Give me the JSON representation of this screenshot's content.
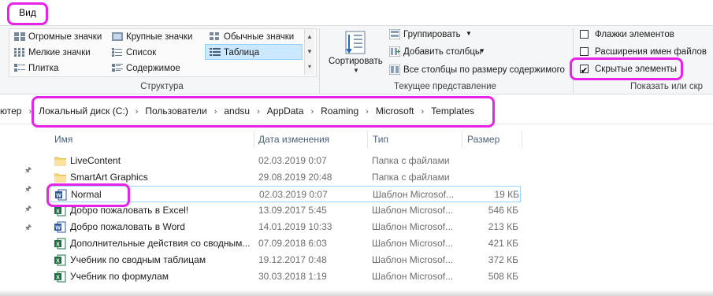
{
  "tabs": {
    "view": "Вид"
  },
  "ribbon": {
    "layout": {
      "col1": [
        "Огромные значки",
        "Мелкие значки",
        "Плитка"
      ],
      "col2": [
        "Крупные значки",
        "Список",
        "Содержимое"
      ],
      "col3": [
        "Обычные значки",
        "Таблица"
      ],
      "selected": "Таблица",
      "group_label": "Структура"
    },
    "current_view": {
      "sort_label": "Сортировать",
      "group_by": "Группировать",
      "add_columns": "Добавить столбцы",
      "size_all_columns": "Все столбцы по размеру содержимого",
      "group_label": "Текущее представление"
    },
    "show_hide": {
      "item_checkboxes": {
        "label": "Флажки элементов",
        "checked": false
      },
      "file_extensions": {
        "label": "Расширения имен файлов",
        "checked": false
      },
      "hidden_items": {
        "label": "Скрытые элементы",
        "checked": true
      },
      "group_label": "Показать или скр"
    }
  },
  "address": {
    "leading": "ютер",
    "crumbs": [
      "Локальный диск (C:)",
      "Пользователи",
      "andsu",
      "AppData",
      "Roaming",
      "Microsoft",
      "Templates"
    ]
  },
  "columns": {
    "name": "Имя",
    "date": "Дата изменения",
    "type": "Тип",
    "size": "Размер"
  },
  "files": [
    {
      "name": "LiveContent",
      "date": "02.03.2019 0:07",
      "type": "Папка с файлами",
      "size": "",
      "icon": "folder-icon"
    },
    {
      "name": "SmartArt Graphics",
      "date": "29.08.2019 20:48",
      "type": "Папка с файлами",
      "size": "",
      "icon": "folder-icon"
    },
    {
      "name": "Normal",
      "date": "02.03.2019 0:07",
      "type": "Шаблон Microsof...",
      "size": "19 КБ",
      "icon": "word-template-icon"
    },
    {
      "name": "Добро пожаловать в Excel!",
      "date": "13.09.2017 5:45",
      "type": "Шаблон Microsof...",
      "size": "546 КБ",
      "icon": "excel-template-icon"
    },
    {
      "name": "Добро пожаловать в Word",
      "date": "14.01.2019 10:33",
      "type": "Шаблон Microsof...",
      "size": "213 КБ",
      "icon": "word-template-icon"
    },
    {
      "name": "Дополнительные действия со сводным...",
      "date": "07.09.2018 6:03",
      "type": "Шаблон Microsof...",
      "size": "421 КБ",
      "icon": "excel-template-icon"
    },
    {
      "name": "Учебник по сводным таблицам",
      "date": "19.12.2017 0:48",
      "type": "Шаблон Microsof...",
      "size": "372 КБ",
      "icon": "excel-template-icon"
    },
    {
      "name": "Учебник по формулам",
      "date": "30.03.2018 1:19",
      "type": "Шаблон Microsof...",
      "size": "508 КБ",
      "icon": "excel-template-icon"
    }
  ],
  "colors": {
    "highlight": "#e623e6",
    "selection": "#cce8ff",
    "excel": "#1d7044",
    "word": "#2b579a",
    "folder": "#f8d775"
  }
}
